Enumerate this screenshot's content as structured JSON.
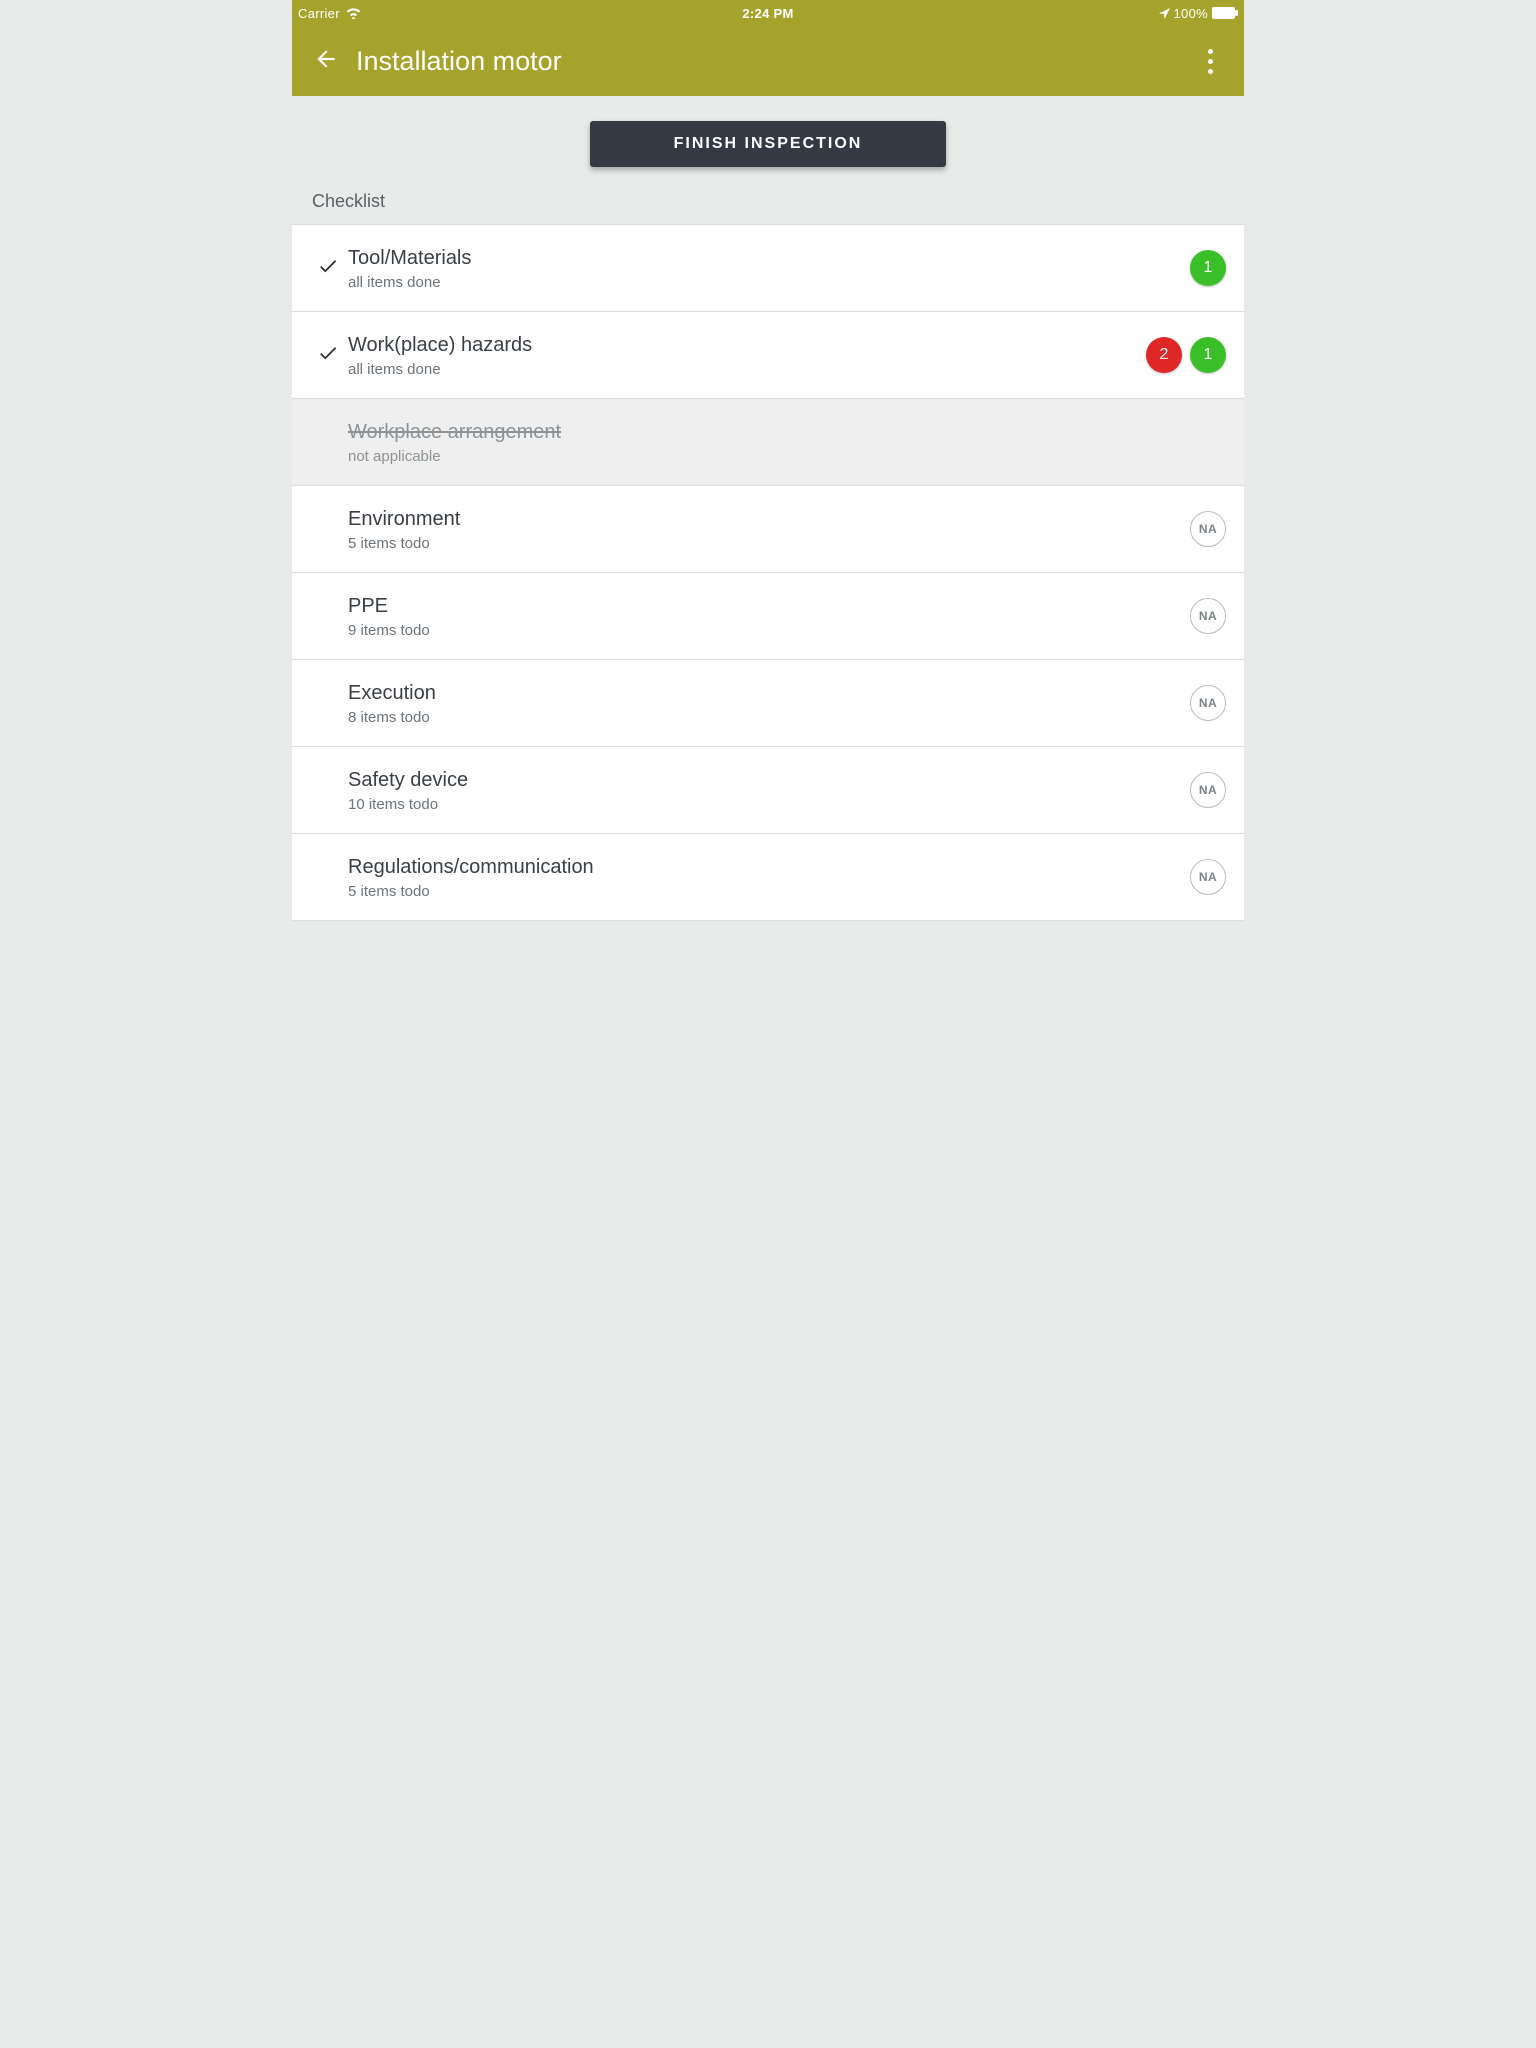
{
  "status": {
    "carrier": "Carrier",
    "time": "2:24 PM",
    "battery": "100%"
  },
  "header": {
    "title": "Installation motor"
  },
  "actions": {
    "finish": "FINISH INSPECTION"
  },
  "section": {
    "title": "Checklist"
  },
  "na_label": "NA",
  "rows": [
    {
      "title": "Tool/Materials",
      "subtitle": "all items done",
      "done": true,
      "na": false,
      "red": null,
      "green": "1"
    },
    {
      "title": "Work(place) hazards",
      "subtitle": "all items done",
      "done": true,
      "na": false,
      "red": "2",
      "green": "1"
    },
    {
      "title": "Workplace arrangement",
      "subtitle": "not applicable",
      "done": false,
      "na": true,
      "red": null,
      "green": null
    },
    {
      "title": "Environment",
      "subtitle": "5 items todo",
      "done": false,
      "na": false,
      "red": null,
      "green": null
    },
    {
      "title": "PPE",
      "subtitle": "9 items todo",
      "done": false,
      "na": false,
      "red": null,
      "green": null
    },
    {
      "title": "Execution",
      "subtitle": "8 items todo",
      "done": false,
      "na": false,
      "red": null,
      "green": null
    },
    {
      "title": "Safety device",
      "subtitle": "10 items todo",
      "done": false,
      "na": false,
      "red": null,
      "green": null
    },
    {
      "title": "Regulations/communication",
      "subtitle": "5 items todo",
      "done": false,
      "na": false,
      "red": null,
      "green": null
    }
  ]
}
